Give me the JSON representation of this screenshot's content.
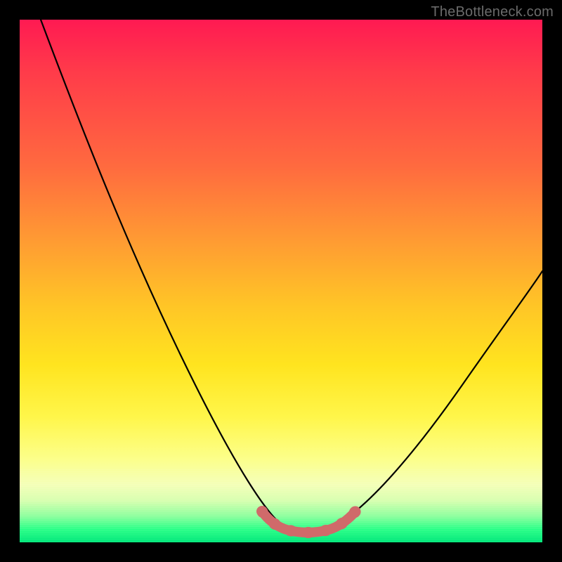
{
  "watermark": "TheBottleneck.com",
  "chart_data": {
    "type": "line",
    "title": "",
    "xlabel": "",
    "ylabel": "",
    "xlim": [
      0,
      100
    ],
    "ylim": [
      0,
      100
    ],
    "grid": false,
    "legend": false,
    "background": {
      "kind": "vertical-gradient",
      "stops": [
        {
          "pos": 0,
          "color": "#ff1a52"
        },
        {
          "pos": 28,
          "color": "#ff6a3f"
        },
        {
          "pos": 55,
          "color": "#ffc626"
        },
        {
          "pos": 76,
          "color": "#fff64a"
        },
        {
          "pos": 92,
          "color": "#d8ffb0"
        },
        {
          "pos": 100,
          "color": "#00e77a"
        }
      ]
    },
    "series": [
      {
        "name": "left-curve",
        "x": [
          4,
          10,
          18,
          26,
          34,
          41,
          46,
          49
        ],
        "y": [
          100,
          80,
          60,
          42,
          26,
          12,
          4,
          1
        ]
      },
      {
        "name": "valley-floor",
        "x": [
          49,
          53,
          58,
          62
        ],
        "y": [
          1,
          0.5,
          0.5,
          1
        ]
      },
      {
        "name": "right-curve",
        "x": [
          62,
          68,
          76,
          84,
          92,
          100
        ],
        "y": [
          1,
          6,
          16,
          28,
          40,
          52
        ]
      }
    ],
    "annotations": [
      {
        "name": "valley-highlight",
        "kind": "thick-segment",
        "color": "#d36b6b",
        "points_x": [
          46,
          49,
          53,
          58,
          62,
          64
        ],
        "points_y": [
          4,
          1,
          0.5,
          0.5,
          1,
          3
        ]
      }
    ]
  }
}
